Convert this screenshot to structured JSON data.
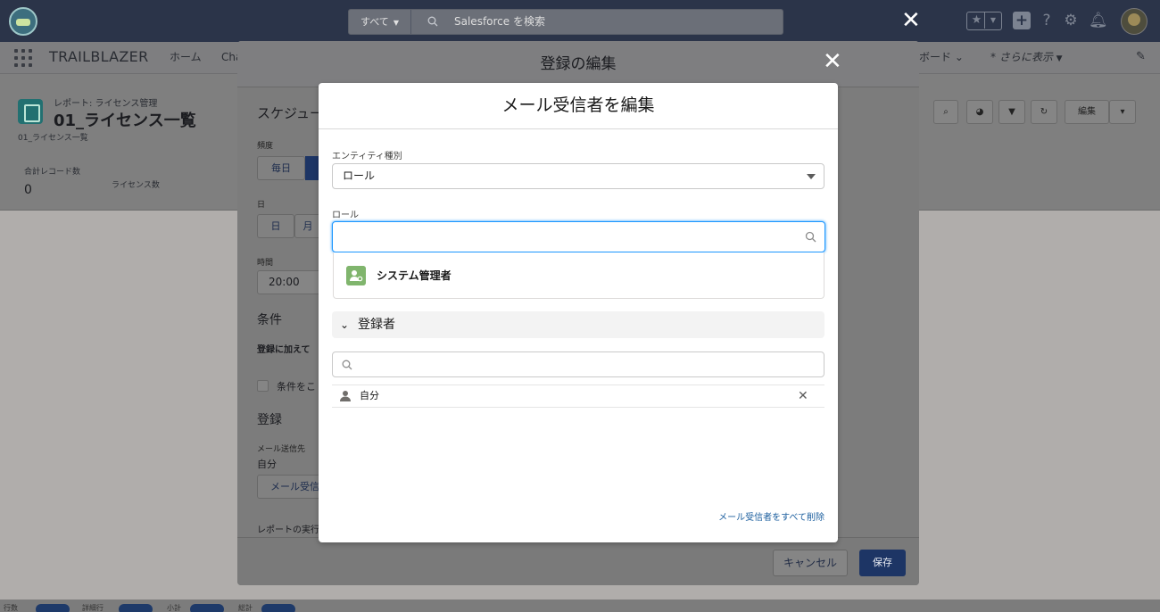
{
  "top": {
    "search_scope": "すべて",
    "search_placeholder": "Salesforce を検索"
  },
  "nav": {
    "app_name": "TRAILBLAZER",
    "home": "ホーム",
    "partial_tab": "Cha",
    "dashboard_partial": "ボード",
    "more": "* さらに表示"
  },
  "report": {
    "crumb": "レポート: ライセンス管理",
    "title": "01_ライセンス一覧",
    "subtitle": "01_ライセンス一覧",
    "record_count_label": "合計レコード数",
    "record_count": "0",
    "license_label": "ライセンス数",
    "edit_button": "編集"
  },
  "outer_modal": {
    "title": "登録の編集",
    "schedule_heading": "スケジュー",
    "frequency_label": "頻度",
    "frequency_daily": "毎日",
    "day_label": "日",
    "day_btn": "日",
    "month_btn": "月",
    "time_label": "時間",
    "time_value": "20:00",
    "conditions_heading": "条件",
    "conditions_text": "登録に加えて",
    "conditions_checkbox": "条件をこ",
    "subscribe_heading": "登録",
    "mail_to_label": "メール送信先",
    "mail_to_value": "自分",
    "mail_recipient_btn": "メール受信",
    "report_exec": "レポートの実行",
    "cancel": "キャンセル",
    "save": "保存"
  },
  "inner_modal": {
    "title": "メール受信者を編集",
    "entity_label": "エンティティ種別",
    "entity_value": "ロール",
    "role_label": "ロール",
    "role_option": "システム管理者",
    "subscribers_title": "登録者",
    "subscriber_name": "自分",
    "remove_all": "メール受信者をすべて削除"
  },
  "bottom": {
    "t1": "行数",
    "t2": "詳細行",
    "t3": "小計",
    "t4": "総計"
  },
  "colors": {
    "brand_dark": "#2b3449",
    "save_btn": "#1d3565",
    "focus_blue": "#1b96ff",
    "link": "#1b5e9e"
  }
}
